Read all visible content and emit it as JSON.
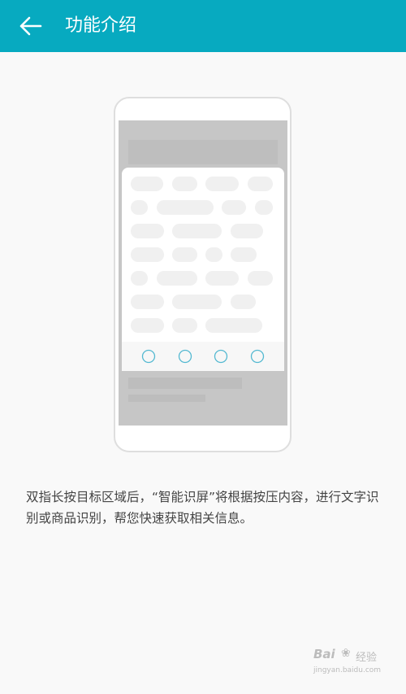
{
  "header": {
    "title": "功能介绍",
    "back_icon": "back-arrow-icon",
    "background": "#07aac0"
  },
  "illustration": {
    "phone_icon": "phone-outline",
    "dots_count": 4
  },
  "description": "双指长按目标区域后，“智能识屏”将根据按压内容，进行文字识别或商品识别，帮您快速获取相关信息。",
  "watermark": {
    "logo": "Bai",
    "logo_suffix": "经验",
    "url": "jingyan.baidu.com"
  }
}
